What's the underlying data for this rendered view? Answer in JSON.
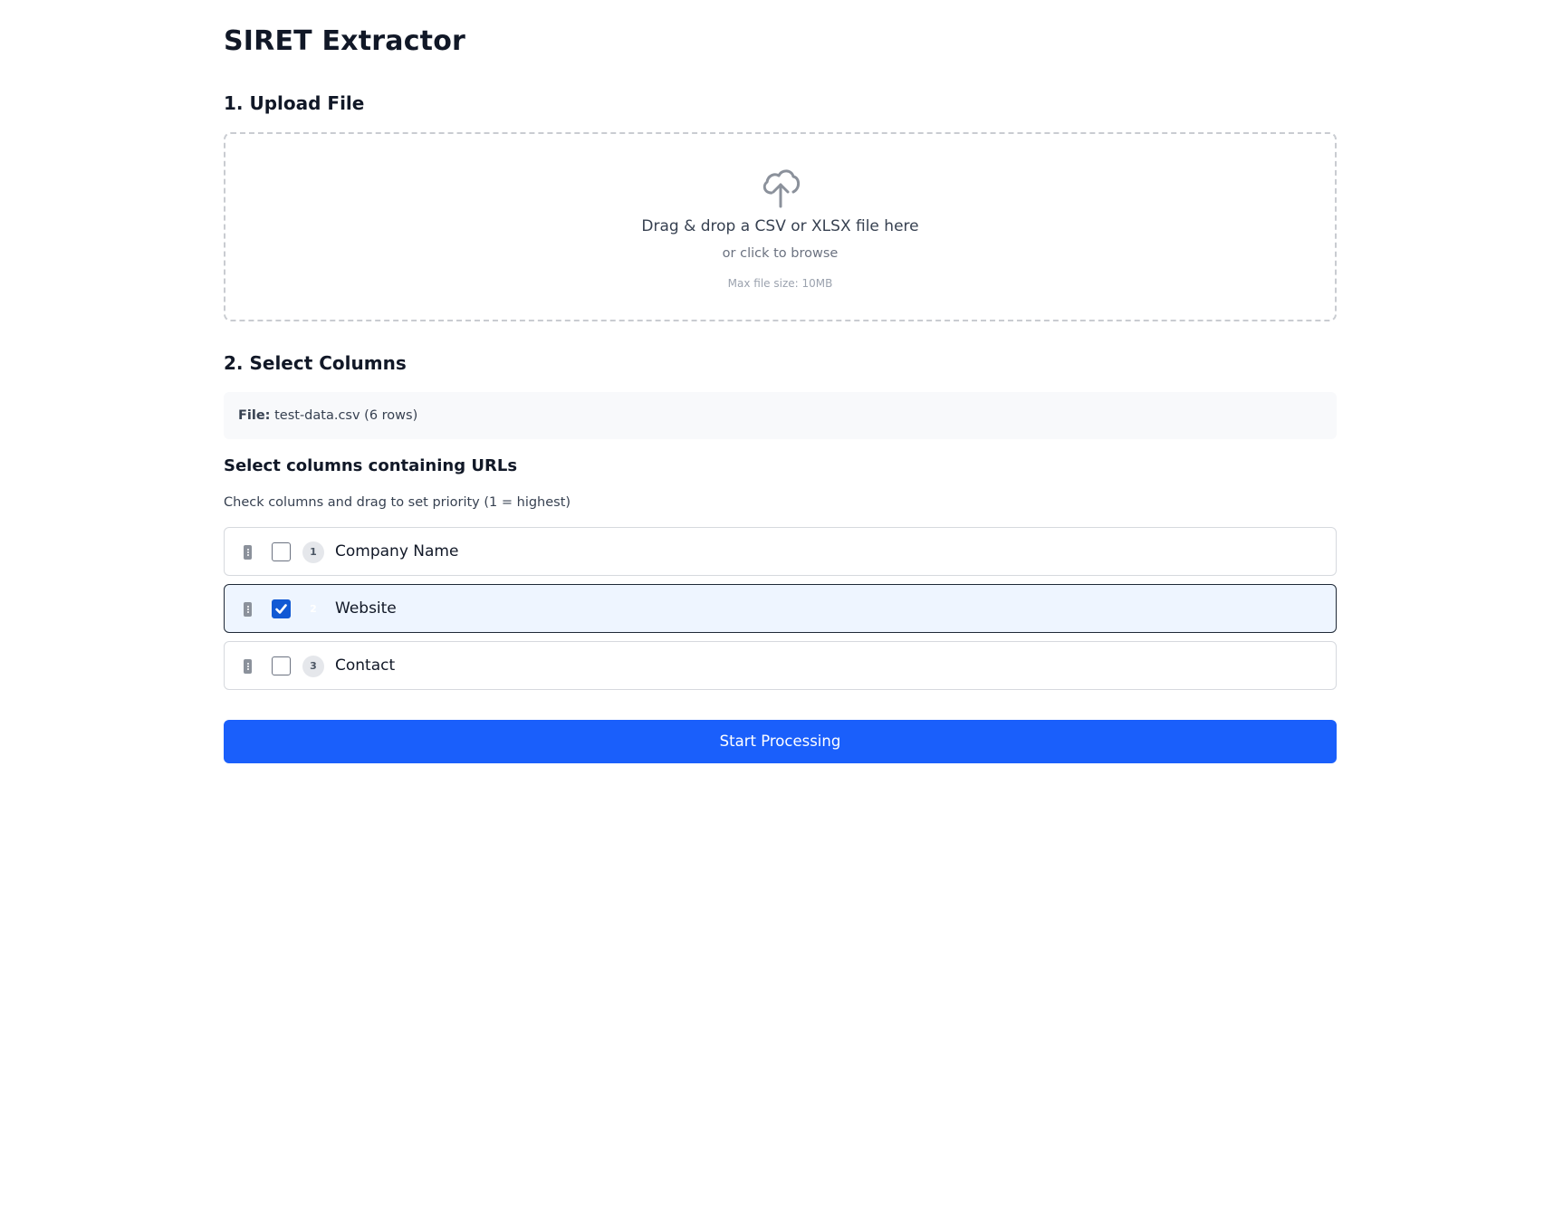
{
  "app": {
    "title": "SIRET Extractor"
  },
  "upload": {
    "heading": "1. Upload File",
    "icon": "cloud-upload-icon",
    "main_text": "Drag & drop a CSV or XLSX file here",
    "sub_text": "or click to browse",
    "note": "Max file size: 10MB"
  },
  "select": {
    "heading": "2. Select Columns",
    "file_label": "File:",
    "file_value": "test-data.csv (6 rows)",
    "subheading": "Select columns containing URLs",
    "help_text": "Check columns and drag to set priority (1 = highest)",
    "columns": [
      {
        "priority": "1",
        "label": "Company Name",
        "checked": false
      },
      {
        "priority": "2",
        "label": "Website",
        "checked": true
      },
      {
        "priority": "3",
        "label": "Contact",
        "checked": false
      }
    ]
  },
  "actions": {
    "start_label": "Start Processing"
  },
  "colors": {
    "accent": "#1a5ffb",
    "checkbox": "#1159d4",
    "selected_row_bg": "#eef5ff"
  }
}
